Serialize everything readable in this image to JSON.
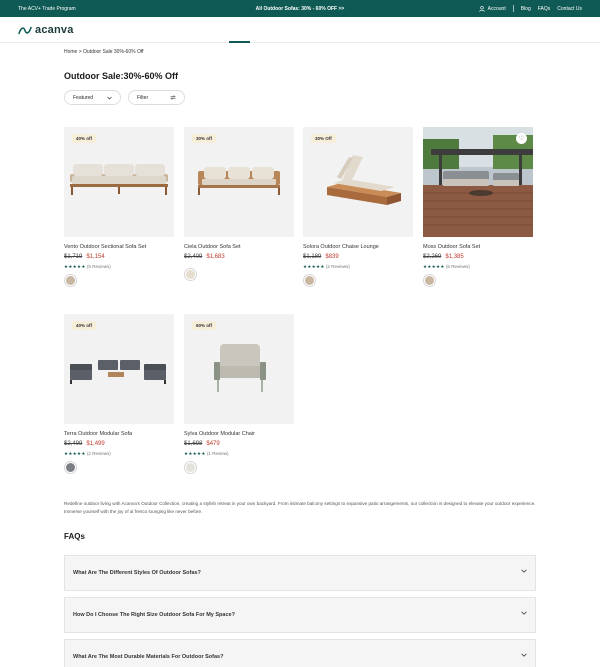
{
  "topbar": {
    "left": "The ACV+ Trade Program",
    "center": "All Outdoor Sofas: 30% - 60% OFF >>",
    "account": "Account",
    "blog": "Blog",
    "faqs": "FAQs",
    "contact": "Contact Us"
  },
  "header": {
    "logo_text": "acanva"
  },
  "breadcrumb": "Home > Outdoor Sale 30%-60% Off",
  "title": "Outdoor Sale:30%-60% Off",
  "controls": {
    "sort_label": "Featured",
    "filter_label": "Filter"
  },
  "products": [
    {
      "badge": "40% off",
      "name": "Vento Outdoor Sectional Sofa Set",
      "old_price": "$1,719",
      "new_price": "$1,154",
      "stars": "★★★★★",
      "reviews": "(5 Reviews)",
      "swatch_color": "#c9b7a1"
    },
    {
      "badge": "30% off",
      "name": "Ciela Outdoor Sofa Set",
      "old_price": "$2,409",
      "new_price": "$1,683",
      "stars": "",
      "reviews": "",
      "swatch_color": "#e6ddd0"
    },
    {
      "badge": "30% Off",
      "name": "Solora Outdoor Chaise Lounge",
      "old_price": "$1,189",
      "new_price": "$839",
      "stars": "★★★★★",
      "reviews": "(2 Reviews)",
      "swatch_color": "#c9b7a1"
    },
    {
      "badge": "",
      "name": "Moss Outdoor Sofa Set",
      "old_price": "$2,269",
      "new_price": "$1,385",
      "stars": "★★★★★",
      "reviews": "(6 Reviews)",
      "swatch_color": "#c9b7a1"
    },
    {
      "badge": "40% off",
      "name": "Terra Outdoor Modular Sofa",
      "old_price": "$2,499",
      "new_price": "$1,499",
      "stars": "★★★★★",
      "reviews": "(2 Reviews)",
      "swatch_color": "#7d7f87"
    },
    {
      "badge": "60% off",
      "name": "Sylva Outdoor Modular Chair",
      "old_price": "$1,698",
      "new_price": "$479",
      "stars": "★★★★★",
      "reviews": "(1 Review)",
      "swatch_color": "#e3e1dc"
    }
  ],
  "intro": "Redefine outdoor living with Acanva's Outdoor Collection, creating a stylish retreat in your own backyard. From intimate balcony settings to expansive patio arrangements, our collection is designed to elevate your outdoor experience. Immerse yourself with the joy of al fresco lounging like never before.",
  "faq_title": "FAQs",
  "faqs": [
    "What Are The Different Styles Of Outdoor Sofas?",
    "How Do I Choose The Right Size Outdoor Sofa For My Space?",
    "What Are The Most Durable Materials For Outdoor Sofas?"
  ],
  "colors": {
    "brand": "#0f5a55",
    "sale_price": "#c0392b",
    "badge_bg": "#f6eed8"
  }
}
